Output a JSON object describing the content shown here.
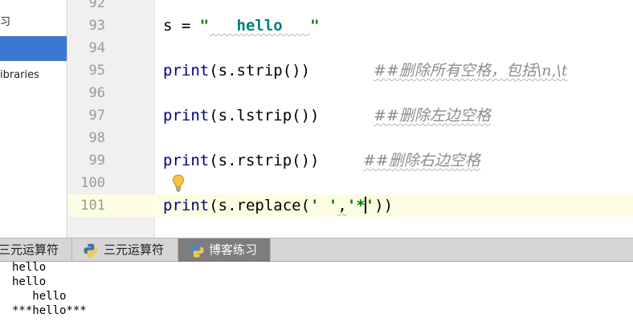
{
  "sidebar": {
    "items": [
      {
        "label": "习"
      },
      {
        "label": ""
      },
      {
        "label": "ibraries"
      }
    ]
  },
  "editor": {
    "line_numbers": [
      "92",
      "93",
      "94",
      "95",
      "96",
      "97",
      "98",
      "99",
      "100",
      "101"
    ],
    "lines": {
      "l93": {
        "var": "s",
        "op": " = ",
        "q_open": "\"",
        "str": "   hello   ",
        "q_close": "\""
      },
      "l95": {
        "fn": "print",
        "rest": "(s.strip())",
        "comment": "##删除所有空格，包括\\n,\\t"
      },
      "l97": {
        "fn": "print",
        "rest": "(s.lstrip())",
        "comment": "##删除左边空格"
      },
      "l99": {
        "fn": "print",
        "rest": "(s.rstrip())",
        "comment": "##删除右边空格"
      },
      "l101": {
        "fn": "print",
        "pre": "(s.replace(",
        "arg1": "' '",
        "comma": ",",
        "arg2_a": "'*",
        "arg2_b": "'",
        "close": "))"
      }
    },
    "intention_icon": "lightbulb-icon",
    "colors": {
      "keyword": "#000080",
      "string": "#008080",
      "comment": "#8c8c8c",
      "current_line": "#fdfde3",
      "selection": "#3b78d0"
    }
  },
  "run_tabs": [
    {
      "label": "三元运算符",
      "icon": "",
      "active": false
    },
    {
      "label": "三元运算符",
      "icon": "python-icon",
      "active": false
    },
    {
      "label": "博客练习",
      "icon": "python-icon",
      "active": true
    }
  ],
  "console": {
    "lines": [
      "hello",
      "hello",
      "   hello",
      "***hello***"
    ]
  }
}
